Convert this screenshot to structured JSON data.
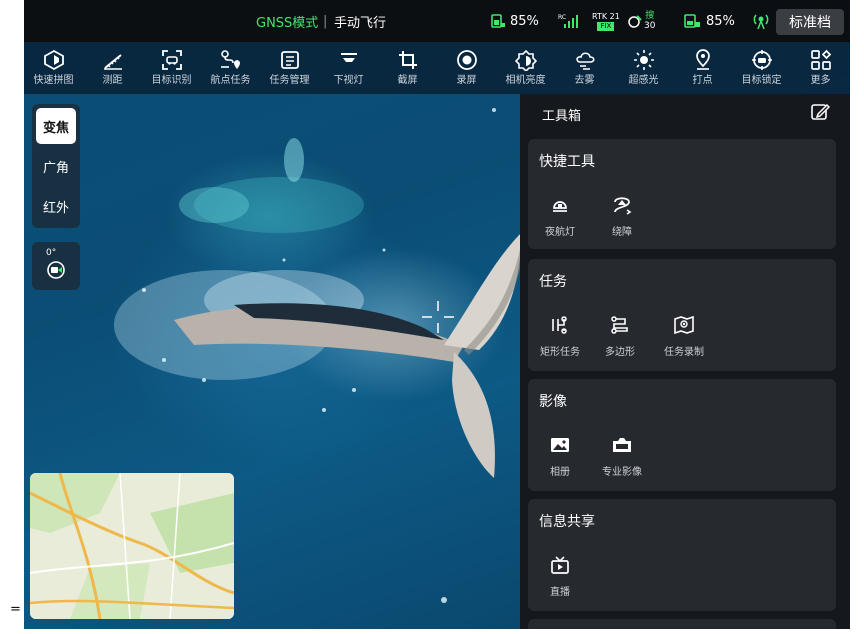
{
  "status_bar": {
    "gnss_mode": "GNSS模式",
    "separator": "|",
    "flight_mode": "手动飞行",
    "battery1": "85%",
    "rc_label": "RC",
    "rtk_label": "RTK",
    "rtk_count": "21",
    "rtk_fix": "FIX",
    "sat_label": "搜",
    "sat_count": "30",
    "battery2": "85%",
    "mode_button": "标准档"
  },
  "toolbar": {
    "items": [
      {
        "label": "快速拼图",
        "icon": "quick-mosaic-icon"
      },
      {
        "label": "测距",
        "icon": "ruler-icon"
      },
      {
        "label": "目标识别",
        "icon": "target-recognition-icon"
      },
      {
        "label": "航点任务",
        "icon": "waypoint-icon"
      },
      {
        "label": "任务管理",
        "icon": "task-manage-icon"
      },
      {
        "label": "下视灯",
        "icon": "down-light-icon"
      },
      {
        "label": "截屏",
        "icon": "crop-icon"
      },
      {
        "label": "录屏",
        "icon": "record-icon"
      },
      {
        "label": "相机亮度",
        "icon": "camera-brightness-icon"
      },
      {
        "label": "去雾",
        "icon": "defog-icon"
      },
      {
        "label": "超感光",
        "icon": "sun-icon"
      },
      {
        "label": "打点",
        "icon": "pin-icon"
      },
      {
        "label": "目标锁定",
        "icon": "target-lock-icon"
      },
      {
        "label": "更多",
        "icon": "more-grid-icon"
      }
    ]
  },
  "lens": {
    "zoom": "变焦",
    "wide": "广角",
    "infrared": "红外"
  },
  "gimbal": {
    "angle": "0°"
  },
  "toolbox": {
    "title": "工具箱",
    "sections": [
      {
        "title": "快捷工具",
        "items": [
          {
            "label": "夜航灯",
            "icon": "night-light-icon"
          },
          {
            "label": "绕障",
            "icon": "obstacle-avoid-icon"
          }
        ]
      },
      {
        "title": "任务",
        "items": [
          {
            "label": "矩形任务",
            "icon": "rect-task-icon"
          },
          {
            "label": "多边形",
            "icon": "polygon-icon"
          },
          {
            "label": "任务录制",
            "icon": "task-record-icon"
          }
        ]
      },
      {
        "title": "影像",
        "items": [
          {
            "label": "相册",
            "icon": "album-icon"
          },
          {
            "label": "专业影像",
            "icon": "pro-imaging-icon"
          }
        ]
      },
      {
        "title": "信息共享",
        "items": [
          {
            "label": "直播",
            "icon": "live-tv-icon"
          }
        ]
      }
    ]
  },
  "colors": {
    "accent_green": "#3ee86a",
    "panel_bg": "#15181c",
    "card_bg": "#26292e"
  },
  "page_marker": "="
}
